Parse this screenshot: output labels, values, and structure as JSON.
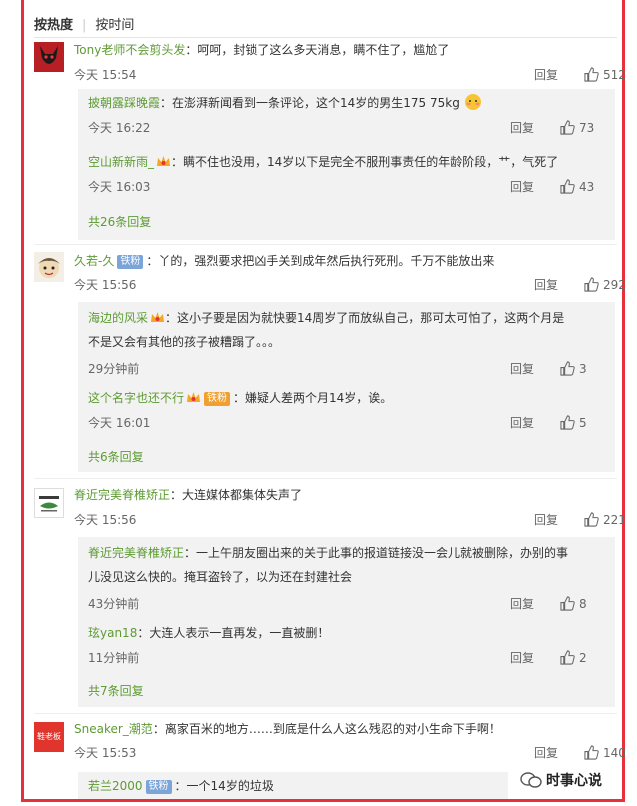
{
  "tabs": {
    "hot": "按热度",
    "time": "按时间"
  },
  "comments": [
    {
      "user": "Tony老师不会剪头发",
      "text": "：呵呵，封锁了这么多天消息，瞒不住了，尴尬了",
      "time": "今天 15:54",
      "reply_label": "回复",
      "likes": "512",
      "replies": [
        {
          "user": "披朝露踩晚霞",
          "text": "：在澎湃新闻看到一条评论，这个14岁的男生175 75kg",
          "time": "今天 16:22",
          "reply_label": "回复",
          "likes": "73"
        },
        {
          "user": "空山新新雨_",
          "text": "：瞒不住也没用，14岁以下是完全不服刑事责任的年龄阶段，艹，气死了",
          "time": "今天 16:03",
          "reply_label": "回复",
          "likes": "43"
        }
      ],
      "more": "共26条回复"
    },
    {
      "user": "久若-久",
      "badge": "铁粉",
      "text": "：丫的，强烈要求把凶手关到成年然后执行死刑。千万不能放出来",
      "time": "今天 15:56",
      "reply_label": "回复",
      "likes": "292",
      "replies": [
        {
          "user": "海边的风采",
          "text_line1": "：这小子要是因为就快要14周岁了而放纵自己，那可太可怕了，这两个月是",
          "text_line2": "不是又会有其他的孩子被糟蹋了。。。",
          "time": "29分钟前",
          "reply_label": "回复",
          "likes": "3"
        },
        {
          "user": "这个名字也还不行",
          "badge": "铁粉",
          "text": "：嫌疑人差两个月14岁，诶。",
          "time": "今天 16:01",
          "reply_label": "回复",
          "likes": "5"
        }
      ],
      "more": "共6条回复"
    },
    {
      "user": "脊近完美脊椎矫正",
      "text": "：大连媒体都集体失声了",
      "time": "今天 15:56",
      "reply_label": "回复",
      "likes": "221",
      "replies": [
        {
          "user": "脊近完美脊椎矫正",
          "text_line1": "：一上午朋友圈出来的关于此事的报道链接没一会儿就被删除，办别的事",
          "text_line2": "儿没见这么快的。掩耳盗铃了，以为还在封建社会",
          "time": "43分钟前",
          "reply_label": "回复",
          "likes": "8"
        },
        {
          "user": "玹yan18",
          "text": "：大连人表示一直再发，一直被删！",
          "time": "11分钟前",
          "reply_label": "回复",
          "likes": "2"
        }
      ],
      "more": "共7条回复"
    },
    {
      "user": "Sneaker_潮范",
      "avatar_text": "鞋老板",
      "text": "：离家百米的地方……到底是什么人这么残忍的对小生命下手啊！",
      "time": "今天 15:53",
      "reply_label": "回复",
      "likes": "140",
      "replies": [
        {
          "user": "若兰2000",
          "badge": "铁粉",
          "text": "：一个14岁的垃圾"
        }
      ]
    }
  ],
  "watermark": "时事心说",
  "colors": {
    "frame": "#e8303b",
    "username": "#5e9b34",
    "reply_bg": "#f2f2f2",
    "badge": "#7ba5d9"
  }
}
